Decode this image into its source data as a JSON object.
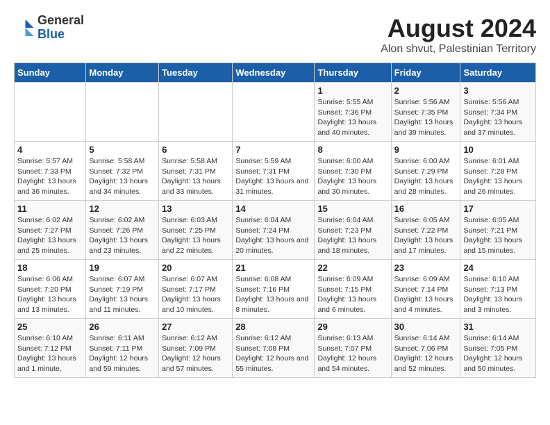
{
  "logo": {
    "general": "General",
    "blue": "Blue"
  },
  "header": {
    "title": "August 2024",
    "subtitle": "Alon shvut, Palestinian Territory"
  },
  "weekdays": [
    "Sunday",
    "Monday",
    "Tuesday",
    "Wednesday",
    "Thursday",
    "Friday",
    "Saturday"
  ],
  "weeks": [
    [
      {
        "day": "",
        "sunrise": "",
        "sunset": "",
        "daylight": ""
      },
      {
        "day": "",
        "sunrise": "",
        "sunset": "",
        "daylight": ""
      },
      {
        "day": "",
        "sunrise": "",
        "sunset": "",
        "daylight": ""
      },
      {
        "day": "",
        "sunrise": "",
        "sunset": "",
        "daylight": ""
      },
      {
        "day": "1",
        "sunrise": "Sunrise: 5:55 AM",
        "sunset": "Sunset: 7:36 PM",
        "daylight": "Daylight: 13 hours and 40 minutes."
      },
      {
        "day": "2",
        "sunrise": "Sunrise: 5:56 AM",
        "sunset": "Sunset: 7:35 PM",
        "daylight": "Daylight: 13 hours and 39 minutes."
      },
      {
        "day": "3",
        "sunrise": "Sunrise: 5:56 AM",
        "sunset": "Sunset: 7:34 PM",
        "daylight": "Daylight: 13 hours and 37 minutes."
      }
    ],
    [
      {
        "day": "4",
        "sunrise": "Sunrise: 5:57 AM",
        "sunset": "Sunset: 7:33 PM",
        "daylight": "Daylight: 13 hours and 36 minutes."
      },
      {
        "day": "5",
        "sunrise": "Sunrise: 5:58 AM",
        "sunset": "Sunset: 7:32 PM",
        "daylight": "Daylight: 13 hours and 34 minutes."
      },
      {
        "day": "6",
        "sunrise": "Sunrise: 5:58 AM",
        "sunset": "Sunset: 7:31 PM",
        "daylight": "Daylight: 13 hours and 33 minutes."
      },
      {
        "day": "7",
        "sunrise": "Sunrise: 5:59 AM",
        "sunset": "Sunset: 7:31 PM",
        "daylight": "Daylight: 13 hours and 31 minutes."
      },
      {
        "day": "8",
        "sunrise": "Sunrise: 6:00 AM",
        "sunset": "Sunset: 7:30 PM",
        "daylight": "Daylight: 13 hours and 30 minutes."
      },
      {
        "day": "9",
        "sunrise": "Sunrise: 6:00 AM",
        "sunset": "Sunset: 7:29 PM",
        "daylight": "Daylight: 13 hours and 28 minutes."
      },
      {
        "day": "10",
        "sunrise": "Sunrise: 6:01 AM",
        "sunset": "Sunset: 7:28 PM",
        "daylight": "Daylight: 13 hours and 26 minutes."
      }
    ],
    [
      {
        "day": "11",
        "sunrise": "Sunrise: 6:02 AM",
        "sunset": "Sunset: 7:27 PM",
        "daylight": "Daylight: 13 hours and 25 minutes."
      },
      {
        "day": "12",
        "sunrise": "Sunrise: 6:02 AM",
        "sunset": "Sunset: 7:26 PM",
        "daylight": "Daylight: 13 hours and 23 minutes."
      },
      {
        "day": "13",
        "sunrise": "Sunrise: 6:03 AM",
        "sunset": "Sunset: 7:25 PM",
        "daylight": "Daylight: 13 hours and 22 minutes."
      },
      {
        "day": "14",
        "sunrise": "Sunrise: 6:04 AM",
        "sunset": "Sunset: 7:24 PM",
        "daylight": "Daylight: 13 hours and 20 minutes."
      },
      {
        "day": "15",
        "sunrise": "Sunrise: 6:04 AM",
        "sunset": "Sunset: 7:23 PM",
        "daylight": "Daylight: 13 hours and 18 minutes."
      },
      {
        "day": "16",
        "sunrise": "Sunrise: 6:05 AM",
        "sunset": "Sunset: 7:22 PM",
        "daylight": "Daylight: 13 hours and 17 minutes."
      },
      {
        "day": "17",
        "sunrise": "Sunrise: 6:05 AM",
        "sunset": "Sunset: 7:21 PM",
        "daylight": "Daylight: 13 hours and 15 minutes."
      }
    ],
    [
      {
        "day": "18",
        "sunrise": "Sunrise: 6:06 AM",
        "sunset": "Sunset: 7:20 PM",
        "daylight": "Daylight: 13 hours and 13 minutes."
      },
      {
        "day": "19",
        "sunrise": "Sunrise: 6:07 AM",
        "sunset": "Sunset: 7:19 PM",
        "daylight": "Daylight: 13 hours and 11 minutes."
      },
      {
        "day": "20",
        "sunrise": "Sunrise: 6:07 AM",
        "sunset": "Sunset: 7:17 PM",
        "daylight": "Daylight: 13 hours and 10 minutes."
      },
      {
        "day": "21",
        "sunrise": "Sunrise: 6:08 AM",
        "sunset": "Sunset: 7:16 PM",
        "daylight": "Daylight: 13 hours and 8 minutes."
      },
      {
        "day": "22",
        "sunrise": "Sunrise: 6:09 AM",
        "sunset": "Sunset: 7:15 PM",
        "daylight": "Daylight: 13 hours and 6 minutes."
      },
      {
        "day": "23",
        "sunrise": "Sunrise: 6:09 AM",
        "sunset": "Sunset: 7:14 PM",
        "daylight": "Daylight: 13 hours and 4 minutes."
      },
      {
        "day": "24",
        "sunrise": "Sunrise: 6:10 AM",
        "sunset": "Sunset: 7:13 PM",
        "daylight": "Daylight: 13 hours and 3 minutes."
      }
    ],
    [
      {
        "day": "25",
        "sunrise": "Sunrise: 6:10 AM",
        "sunset": "Sunset: 7:12 PM",
        "daylight": "Daylight: 13 hours and 1 minute."
      },
      {
        "day": "26",
        "sunrise": "Sunrise: 6:11 AM",
        "sunset": "Sunset: 7:11 PM",
        "daylight": "Daylight: 12 hours and 59 minutes."
      },
      {
        "day": "27",
        "sunrise": "Sunrise: 6:12 AM",
        "sunset": "Sunset: 7:09 PM",
        "daylight": "Daylight: 12 hours and 57 minutes."
      },
      {
        "day": "28",
        "sunrise": "Sunrise: 6:12 AM",
        "sunset": "Sunset: 7:08 PM",
        "daylight": "Daylight: 12 hours and 55 minutes."
      },
      {
        "day": "29",
        "sunrise": "Sunrise: 6:13 AM",
        "sunset": "Sunset: 7:07 PM",
        "daylight": "Daylight: 12 hours and 54 minutes."
      },
      {
        "day": "30",
        "sunrise": "Sunrise: 6:14 AM",
        "sunset": "Sunset: 7:06 PM",
        "daylight": "Daylight: 12 hours and 52 minutes."
      },
      {
        "day": "31",
        "sunrise": "Sunrise: 6:14 AM",
        "sunset": "Sunset: 7:05 PM",
        "daylight": "Daylight: 12 hours and 50 minutes."
      }
    ]
  ]
}
